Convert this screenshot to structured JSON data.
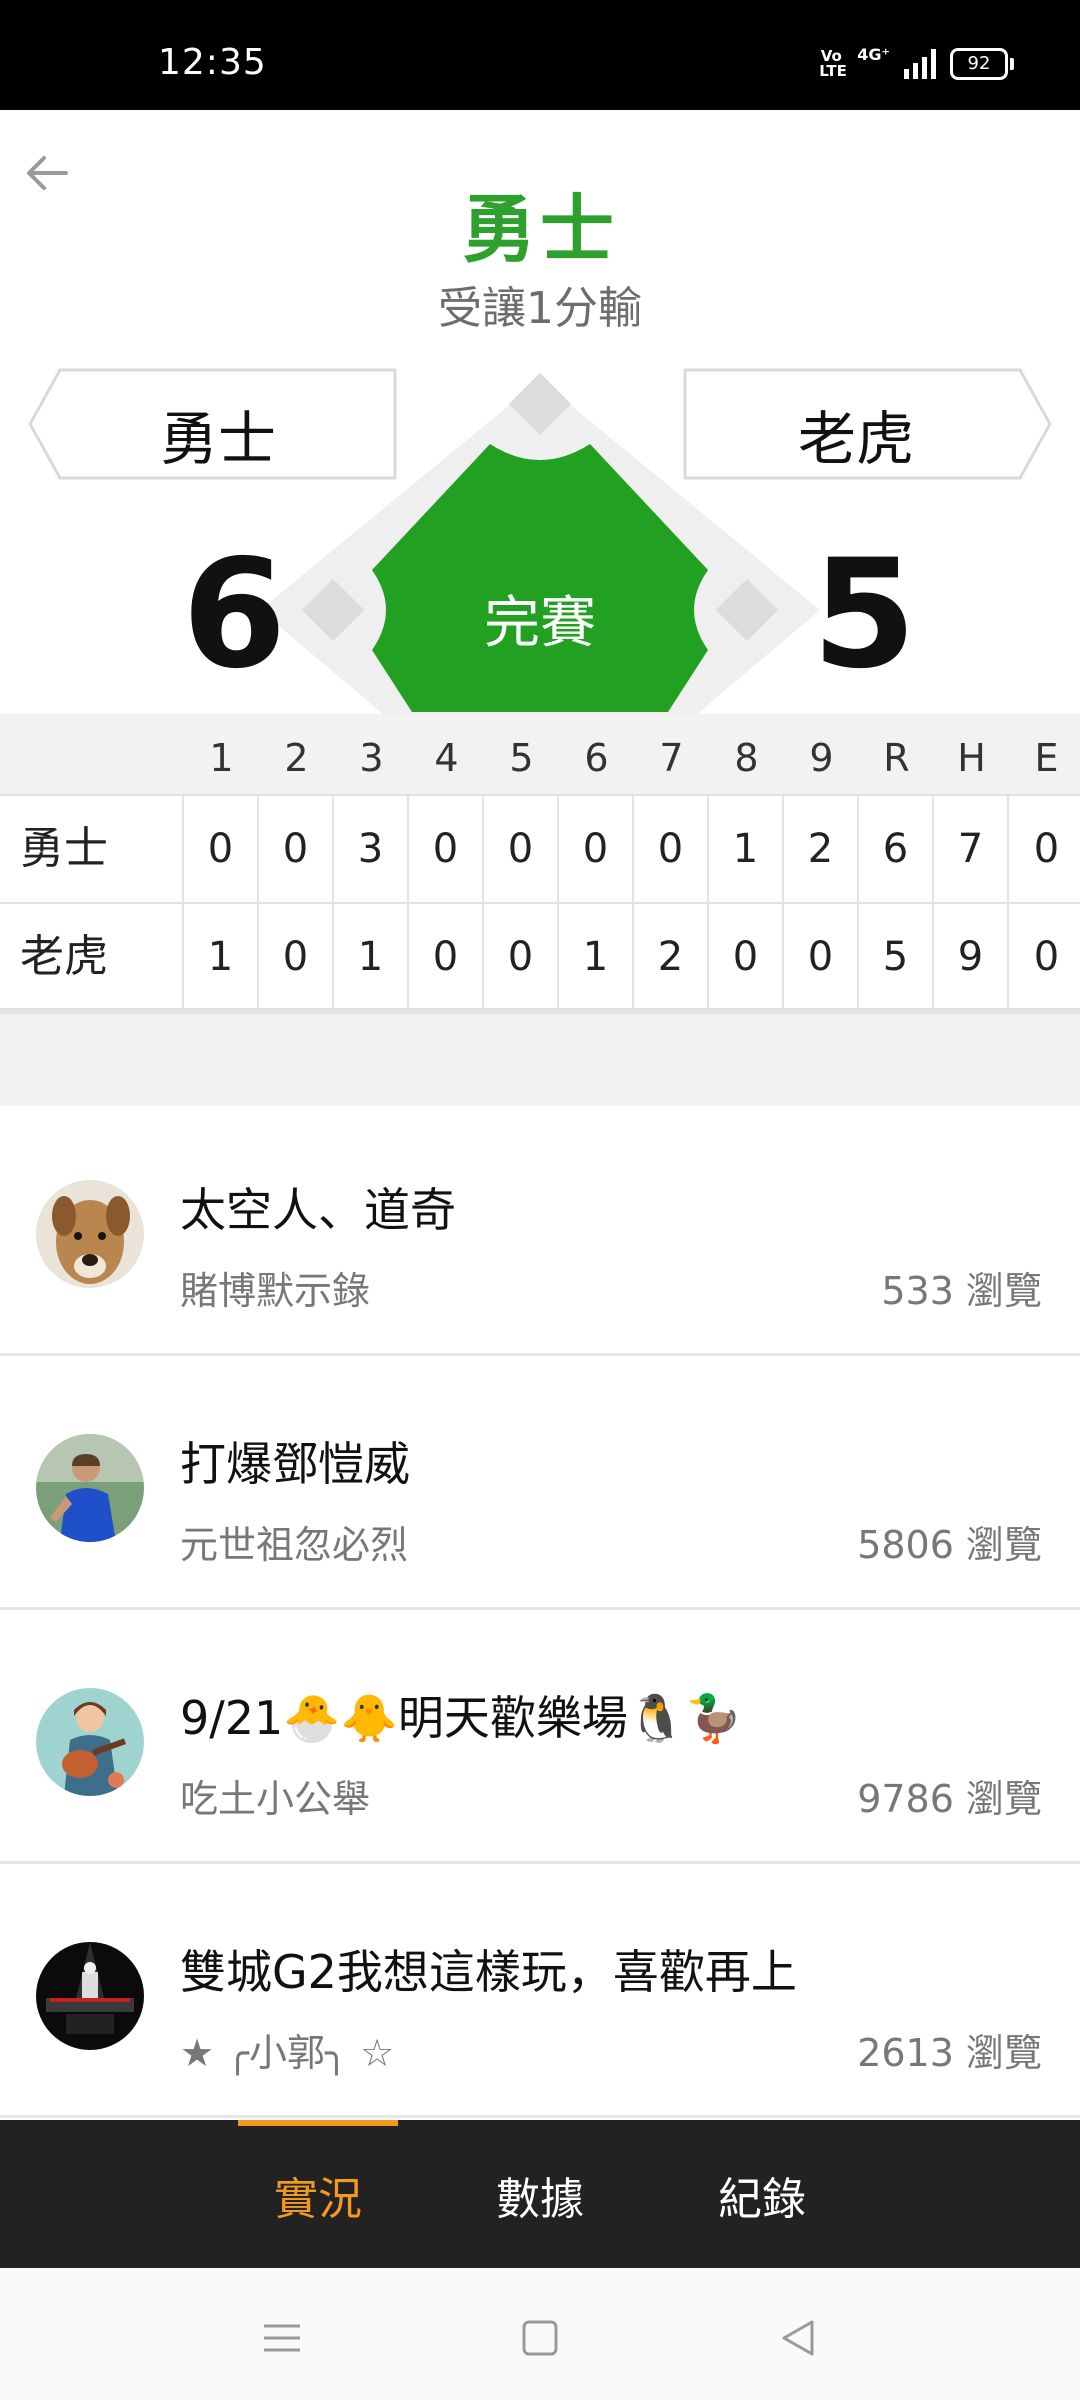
{
  "status_bar": {
    "time": "12:35",
    "volte": "Vo\nLTE",
    "network": "4G⁺",
    "battery": "92"
  },
  "header": {
    "title": "勇士",
    "subtitle": "受讓1分輸"
  },
  "game": {
    "home_team": "勇士",
    "away_team": "老虎",
    "home_score": "6",
    "away_score": "5",
    "status": "完賽",
    "field_color": "#22a022"
  },
  "linescore": {
    "columns": [
      "1",
      "2",
      "3",
      "4",
      "5",
      "6",
      "7",
      "8",
      "9",
      "R",
      "H",
      "E"
    ],
    "rows": [
      {
        "team": "勇士",
        "values": [
          "0",
          "0",
          "3",
          "0",
          "0",
          "0",
          "0",
          "1",
          "2",
          "6",
          "7",
          "0"
        ]
      },
      {
        "team": "老虎",
        "values": [
          "1",
          "0",
          "1",
          "0",
          "0",
          "1",
          "2",
          "0",
          "0",
          "5",
          "9",
          "0"
        ]
      }
    ]
  },
  "posts": [
    {
      "title": "太空人、道奇",
      "author": "賭博默示錄",
      "views": "533 瀏覽",
      "avatar": "dog-avatar"
    },
    {
      "title": "打爆鄧愷威",
      "author": "元世祖忽必烈",
      "views": "5806 瀏覽",
      "avatar": "soccer-player-avatar"
    },
    {
      "title": "9/21🐣🐥明天歡樂場🐧🦆",
      "author": "吃土小公舉",
      "views": "9786 瀏覽",
      "avatar": "guitar-illustration-avatar"
    },
    {
      "title": "雙城G2我想這樣玩，喜歡再上",
      "author": "★ ╭小郭╮ ☆",
      "views": "2613 瀏覽",
      "avatar": "stage-avatar"
    }
  ],
  "tabs": [
    {
      "label": "實況",
      "active": true
    },
    {
      "label": "數據",
      "active": false
    },
    {
      "label": "紀錄",
      "active": false
    }
  ],
  "colors": {
    "accent_green": "#2ea02e",
    "tab_active": "#f39a1e",
    "tab_bar": "#222222"
  },
  "nav": {
    "menu": "menu-icon",
    "home": "home-square-icon",
    "back": "back-triangle-icon"
  }
}
